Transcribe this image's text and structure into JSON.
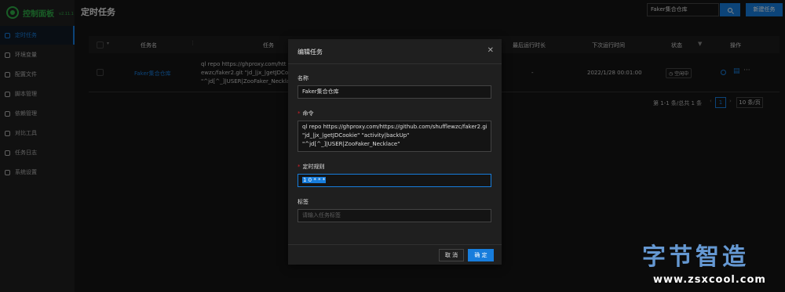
{
  "app": {
    "logo_text": "控制面板",
    "version": "v2.11.1"
  },
  "sidebar": {
    "items": [
      {
        "label": "定时任务",
        "icon": "clock-icon",
        "active": true
      },
      {
        "label": "环境变量",
        "icon": "env-icon"
      },
      {
        "label": "配置文件",
        "icon": "config-file-icon"
      },
      {
        "label": "脚本管理",
        "icon": "script-icon"
      },
      {
        "label": "依赖管理",
        "icon": "dependency-icon"
      },
      {
        "label": "对比工具",
        "icon": "diff-icon"
      },
      {
        "label": "任务日志",
        "icon": "log-icon"
      },
      {
        "label": "系统设置",
        "icon": "settings-icon"
      }
    ]
  },
  "header": {
    "title": "定时任务",
    "search_value": "Faker集合仓库",
    "create_button": "新建任务"
  },
  "table": {
    "columns": {
      "name": "任务名",
      "command": "任务",
      "last_duration": "最后运行时长",
      "next_run": "下次运行时间",
      "status": "状态",
      "actions": "操作"
    },
    "rows": [
      {
        "name": "Faker集合仓库",
        "command_lines": [
          "ql repo https://ghproxy.com/htt",
          "ewzc/faker2.git \"jd_|jx_|getJDCook",
          "\"^jd[^_]|USER|ZooFaker_Necklace\""
        ],
        "last_duration": "-",
        "next_run": "2022/1/28 00:01:00",
        "status": "空闲中"
      }
    ]
  },
  "pagination": {
    "summary": "第 1-1 条/总共 1 条",
    "current_page": "1",
    "page_size": "10 条/页"
  },
  "modal": {
    "title": "编辑任务",
    "name_label": "名称",
    "name_value": "Faker集合仓库",
    "command_label": "命令",
    "command_lines": [
      "ql repo https://ghproxy.com/https://github.com/shufflewzc/faker2.git",
      "\"jd_|jx_|getJDCookie\" \"activity|backUp\"",
      "\"^jd[^_]|USER|ZooFaker_Necklace\""
    ],
    "schedule_label": "定时规则",
    "schedule_value": "1 0 * * *",
    "tags_label": "标签",
    "tags_placeholder": "请输入任务标签",
    "cancel_button": "取 消",
    "ok_button": "确 定"
  },
  "watermark": {
    "title": "字节智造",
    "url": "www.zsxcool.com"
  },
  "colors": {
    "accent": "#177ddc",
    "brand": "#2eaa46",
    "required": "#d32029"
  }
}
